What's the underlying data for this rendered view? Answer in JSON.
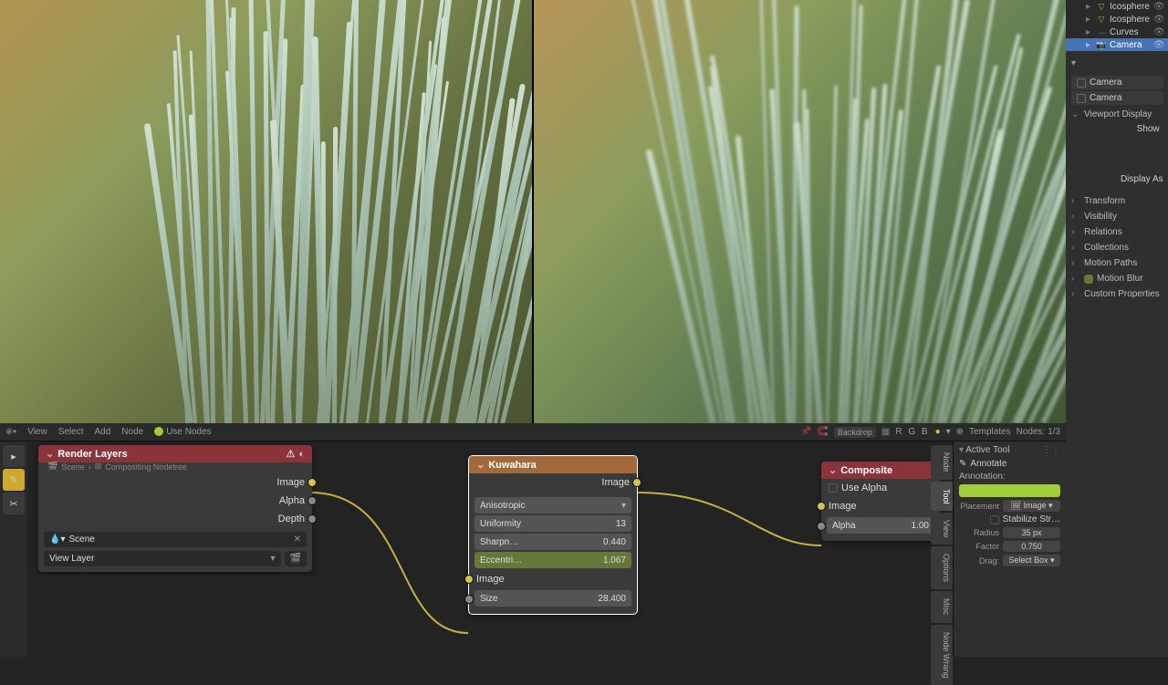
{
  "outliner": {
    "items": [
      {
        "name": "Icosphere",
        "type": "mesh"
      },
      {
        "name": "Icosphere",
        "type": "mesh"
      },
      {
        "name": "Curves",
        "type": "curves"
      },
      {
        "name": "Camera",
        "type": "camera",
        "selected": true
      }
    ]
  },
  "props": {
    "camera_label_1": "Camera",
    "camera_label_2": "Camera",
    "viewport_display": "Viewport Display",
    "show": "Show",
    "display_as": "Display As",
    "sections": [
      "Transform",
      "Visibility",
      "Relations",
      "Collections",
      "Motion Paths",
      "Motion Blur",
      "Custom Properties"
    ]
  },
  "node_editor": {
    "menu": [
      "View",
      "Select",
      "Add",
      "Node"
    ],
    "use_nodes": "Use Nodes",
    "backdrop": "Backdrop",
    "templates": "Templates",
    "nodes_count": "Nodes: 1/3",
    "rgba": "R G B",
    "breadcrumb": [
      "Scene",
      "Compositing Nodetree"
    ]
  },
  "render_layers": {
    "title": "Render Layers",
    "outputs": [
      "Image",
      "Alpha",
      "Depth"
    ],
    "scene_selector": "Scene",
    "view_layer": "View Layer"
  },
  "kuwahara": {
    "title": "Kuwahara",
    "out_image": "Image",
    "type": "Anisotropic",
    "uniformity_label": "Uniformity",
    "uniformity_val": "13",
    "sharpness_label": "Sharpn…",
    "sharpness_val": "0.440",
    "ecc_label": "Eccentri…",
    "ecc_val": "1.067",
    "in_image": "Image",
    "size_label": "Size",
    "size_val": "28.400"
  },
  "composite": {
    "title": "Composite",
    "use_alpha": "Use Alpha",
    "in_image": "Image",
    "alpha_label": "Alpha",
    "alpha_val": "1.00"
  },
  "active_tool": {
    "header": "Active Tool",
    "tool_name": "Annotate",
    "annotation_label": "Annotation:",
    "placement_label": "Placement",
    "placement_value": "Image",
    "stabilize": "Stabilize Str…",
    "radius_label": "Radius",
    "radius_value": "35 px",
    "factor_label": "Factor",
    "factor_value": "0.750",
    "drag_label": "Drag:",
    "drag_value": "Select Box"
  },
  "sidetabs": [
    "Node",
    "Tool",
    "View",
    "Options",
    "Misc",
    "Node Wrang"
  ]
}
